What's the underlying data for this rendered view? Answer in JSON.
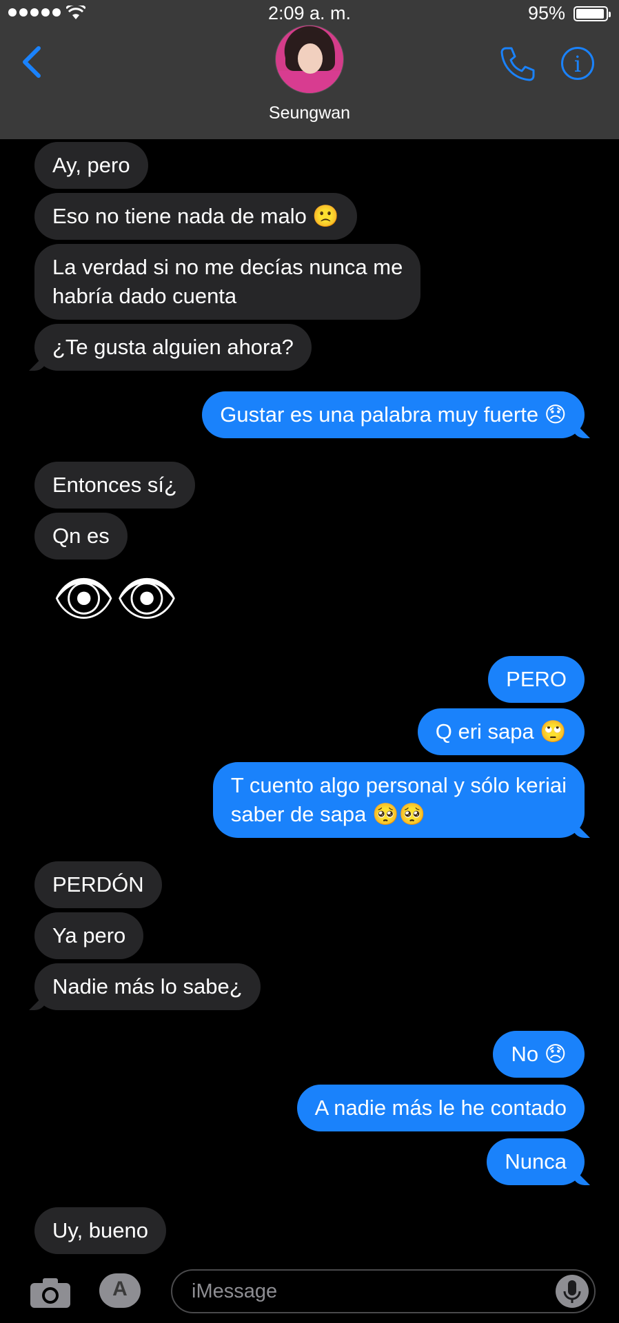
{
  "status_bar": {
    "time": "2:09 a. m.",
    "battery_percent": "95%",
    "signal_bars": 5
  },
  "header": {
    "contact_name": "Seungwan",
    "back_icon": "chevron-left-icon",
    "call_icon": "phone-icon",
    "info_icon": "info-icon",
    "info_glyph": "i",
    "accent_color": "#1a82fb"
  },
  "messages": [
    {
      "direction": "incoming",
      "text": "Ay, pero"
    },
    {
      "direction": "incoming",
      "text": "Eso no tiene nada de malo 🙁"
    },
    {
      "direction": "incoming",
      "text": "La verdad si no me decías nunca me",
      "text2": "habría dado cuenta"
    },
    {
      "direction": "incoming",
      "text": "¿Te gusta alguien ahora?"
    },
    {
      "direction": "outgoing",
      "text": "Gustar es una palabra muy fuerte 😞"
    },
    {
      "direction": "incoming",
      "text": "Entonces sí¿"
    },
    {
      "direction": "incoming",
      "text": "Qn es"
    },
    {
      "direction": "incoming",
      "text": "👁👁"
    },
    {
      "direction": "outgoing",
      "text": "PERO"
    },
    {
      "direction": "outgoing",
      "text": "Q eri sapa 🙄"
    },
    {
      "direction": "outgoing",
      "text": "T cuento algo personal y sólo keriai",
      "text2": "saber de sapa 🥺🥺"
    },
    {
      "direction": "incoming",
      "text": "PERDÓN"
    },
    {
      "direction": "incoming",
      "text": "Ya pero"
    },
    {
      "direction": "incoming",
      "text": "Nadie más lo sabe¿"
    },
    {
      "direction": "outgoing",
      "text": "No 😞"
    },
    {
      "direction": "outgoing",
      "text": "A nadie más le he contado"
    },
    {
      "direction": "outgoing",
      "text": "Nunca"
    },
    {
      "direction": "incoming",
      "text": "Uy, bueno"
    }
  ],
  "composer": {
    "placeholder": "iMessage",
    "camera_icon": "camera-icon",
    "apps_icon": "app-store-icon",
    "apps_glyph": "A",
    "mic_icon": "microphone-icon"
  }
}
